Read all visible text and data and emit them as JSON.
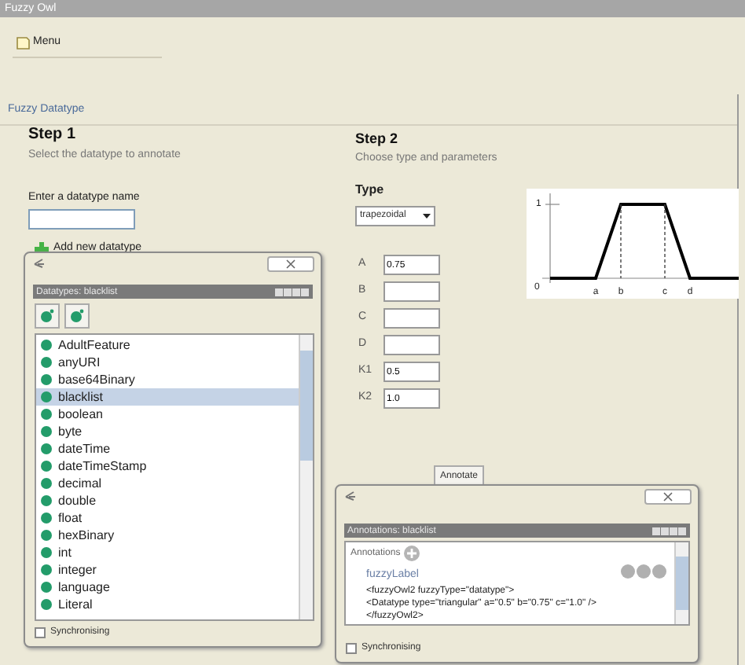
{
  "window": {
    "title": "Fuzzy Owl"
  },
  "menu": {
    "label": "Menu"
  },
  "section": {
    "title": "Fuzzy Datatype"
  },
  "step1": {
    "title": "Step 1",
    "subtitle": "Select the datatype to annotate",
    "name_label": "Enter a datatype name",
    "add_button": "Add new datatype"
  },
  "datatypes_panel": {
    "title": "Datatypes: blacklist",
    "items": [
      {
        "label": "AdultFeature",
        "selected": false
      },
      {
        "label": "anyURI",
        "selected": false
      },
      {
        "label": "base64Binary",
        "selected": false
      },
      {
        "label": "blacklist",
        "selected": true
      },
      {
        "label": "boolean",
        "selected": false
      },
      {
        "label": "byte",
        "selected": false
      },
      {
        "label": "dateTime",
        "selected": false
      },
      {
        "label": "dateTimeStamp",
        "selected": false
      },
      {
        "label": "decimal",
        "selected": false
      },
      {
        "label": "double",
        "selected": false
      },
      {
        "label": "float",
        "selected": false
      },
      {
        "label": "hexBinary",
        "selected": false
      },
      {
        "label": "int",
        "selected": false
      },
      {
        "label": "integer",
        "selected": false
      },
      {
        "label": "language",
        "selected": false
      },
      {
        "label": "Literal",
        "selected": false
      }
    ],
    "synchronising": {
      "label": "Synchronising",
      "checked": false
    }
  },
  "step2": {
    "title": "Step 2",
    "subtitle": "Choose type and parameters",
    "type_label": "Type",
    "type_value": "trapezoidal",
    "parameters": [
      {
        "label": "A",
        "value": "0.75"
      },
      {
        "label": "B"
      },
      {
        "label": "C"
      },
      {
        "label": "D"
      },
      {
        "label": "K1",
        "value": "0.5"
      },
      {
        "label": "K2",
        "value": "1.0"
      }
    ],
    "diagram": {
      "y_labels": [
        "1",
        "0"
      ],
      "x_labels": [
        "a",
        "b",
        "c",
        "d"
      ]
    }
  },
  "annotate_button": "Annotate",
  "annotations_panel": {
    "title": "Annotations: blacklist",
    "header": "Annotations",
    "label": "fuzzyLabel",
    "code_lines": [
      "<fuzzyOwl2 fuzzyType=\"datatype\">",
      "<Datatype type=\"triangular\" a=\"0.5\" b=\"0.75\" c=\"1.0\" />",
      "</fuzzyOwl2>"
    ],
    "synchronising": {
      "label": "Synchronising",
      "checked": false
    }
  }
}
